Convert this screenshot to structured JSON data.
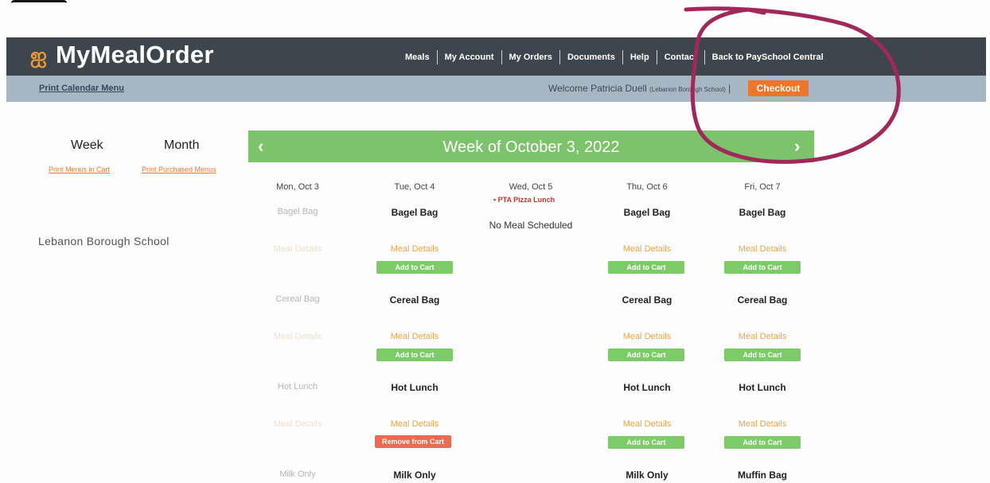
{
  "header": {
    "logo_text": "MyMealOrder",
    "nav": [
      "Meals",
      "My Account",
      "My Orders",
      "Documents",
      "Help",
      "Contact",
      "Back to PaySchool Central"
    ]
  },
  "subbar": {
    "print_calendar": "Print Calendar Menu",
    "welcome": "Welcome Patricia Duell",
    "school_small": "(Lebanon Borough School)",
    "checkout": "Checkout"
  },
  "sidebar": {
    "week_tab": "Week",
    "month_tab": "Month",
    "print_menus_cart": "Print Menus in Cart",
    "print_purchased": "Print Purchased Menus",
    "school_name": "Lebanon Borough School"
  },
  "calendar": {
    "title": "Week of October 3, 2022",
    "prev_icon": "‹",
    "next_icon": "›",
    "days": [
      "Mon, Oct 3",
      "Tue, Oct 4",
      "Wed, Oct 5",
      "Thu, Oct 6",
      "Fri, Oct 7"
    ],
    "event": "PTA Pizza Lunch",
    "no_meal": "No Meal Scheduled",
    "meal_details": "Meal Details",
    "add_to_cart": "Add to Cart",
    "remove_from_cart": "Remove from Cart",
    "mon_meals": [
      "Bagel Bag",
      "Cereal Bag",
      "Hot Lunch",
      "Milk Only"
    ],
    "tue_meals": [
      "Bagel Bag",
      "Cereal Bag",
      "Hot Lunch",
      "Milk Only"
    ],
    "thu_meals": [
      "Bagel Bag",
      "Cereal Bag",
      "Hot Lunch",
      "Milk Only"
    ],
    "fri_meals": [
      "Bagel Bag",
      "Cereal Bag",
      "Hot Lunch",
      "Muffin Bag"
    ]
  },
  "colors": {
    "accent_orange": "#f07528",
    "week_bar_green": "#7dc36b",
    "annotation_circle": "#a0285a"
  }
}
